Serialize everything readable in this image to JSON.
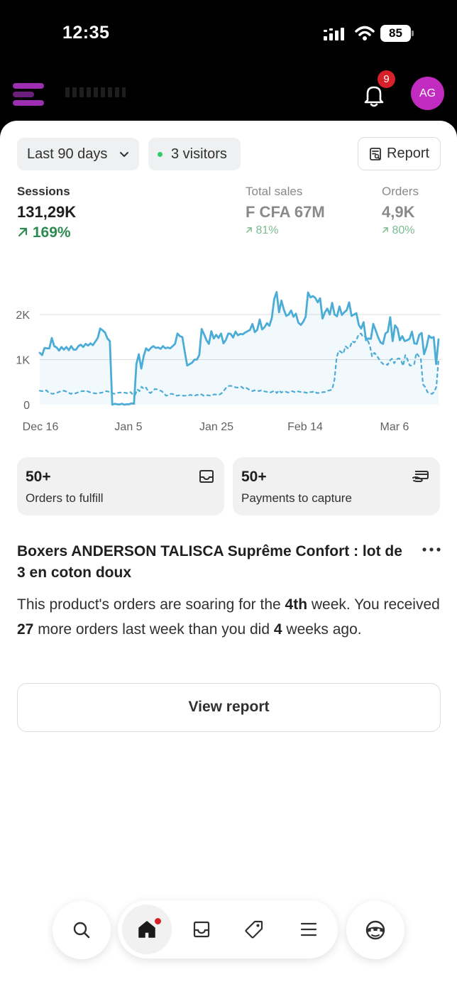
{
  "status_bar": {
    "time": "12:35",
    "battery": "85"
  },
  "header": {
    "notification_count": "9",
    "avatar_initials": "AG"
  },
  "filters": {
    "date_range": "Last 90 days",
    "visitors": "3 visitors",
    "report_button": "Report"
  },
  "metrics": [
    {
      "label": "Sessions",
      "value": "131,29K",
      "delta": "169%"
    },
    {
      "label": "Total sales",
      "value": "F CFA 67M",
      "delta": "81%"
    },
    {
      "label": "Orders",
      "value": "4,9K",
      "delta": "80%"
    }
  ],
  "chart_data": {
    "type": "line",
    "x_tick_labels": [
      "Dec 16",
      "Jan 5",
      "Jan 25",
      "Feb 14",
      "Mar 6"
    ],
    "y_tick_labels": [
      "2K",
      "1K",
      "0"
    ],
    "ylim": [
      0,
      2000
    ],
    "grid": true,
    "series": [
      {
        "style": "solid",
        "color": "#4bacd6",
        "values": [
          1150,
          1100,
          1260,
          1250,
          1250,
          1480,
          1300,
          1270,
          1200,
          1280,
          1220,
          1280,
          1210,
          1300,
          1220,
          1220,
          1300,
          1330,
          1280,
          1350,
          1310,
          1360,
          1320,
          1400,
          1480,
          1690,
          1650,
          1600,
          1470,
          1410,
          0,
          20,
          10,
          5,
          20,
          0,
          10,
          10,
          30,
          20,
          900,
          1120,
          800,
          1080,
          1250,
          1200,
          1260,
          1300,
          1260,
          1270,
          1240,
          1300,
          1250,
          1270,
          1250,
          1300,
          1350,
          1580,
          1520,
          1500,
          1170,
          870,
          900,
          930,
          1000,
          1000,
          1100,
          1680,
          1560,
          1430,
          1350,
          1630,
          1470,
          1550,
          1480,
          1580,
          1360,
          1440,
          1580,
          1570,
          1490,
          1620,
          1540,
          1570,
          1560,
          1600,
          1630,
          1660,
          1790,
          1610,
          1660,
          1890,
          1670,
          1720,
          1810,
          1750,
          1920,
          2340,
          2520,
          2050,
          2310,
          2110,
          1970,
          2000,
          2090,
          1950,
          2020,
          1820,
          1770,
          1840,
          1950,
          2490,
          2380,
          2410,
          2370,
          2270,
          2360,
          1910,
          2050,
          2130,
          2000,
          2260,
          2000,
          1960,
          2180,
          1990,
          2050,
          2100,
          2270,
          1970,
          2000,
          2030,
          1770,
          1690,
          1830,
          1430,
          1470,
          1460,
          1790,
          1650,
          1500,
          1380,
          1350,
          1580,
          1620,
          1940,
          1410,
          1760,
          1690,
          1430,
          1520,
          1410,
          1430,
          1460,
          1620,
          1360,
          1350,
          1550,
          1590,
          1120,
          1280,
          1530,
          1480,
          1500,
          900,
          1450
        ]
      },
      {
        "style": "dashed",
        "color": "#4bacd6",
        "values": [
          310,
          300,
          300,
          320,
          270,
          250,
          240,
          260,
          270,
          290,
          300,
          310,
          290,
          270,
          240,
          260,
          250,
          270,
          280,
          300,
          300,
          310,
          290,
          270,
          260,
          250,
          250,
          260,
          270,
          280,
          300,
          290,
          280,
          250,
          240,
          260,
          270,
          270,
          270,
          260,
          250,
          280,
          230,
          210,
          340,
          300,
          400,
          350,
          380,
          280,
          260,
          300,
          350,
          340,
          320,
          300,
          260,
          200,
          210,
          240,
          240,
          210,
          200,
          210,
          200,
          200,
          200,
          200,
          220,
          200,
          200,
          220,
          210,
          230,
          200,
          210,
          210,
          200,
          220,
          230,
          220,
          220,
          250,
          300,
          370,
          410,
          420,
          410,
          390,
          380,
          380,
          400,
          360,
          380,
          350,
          320,
          300,
          320,
          320,
          300,
          320,
          300,
          290,
          280,
          270,
          290,
          310,
          260,
          320,
          270,
          290,
          290,
          270,
          280,
          300,
          280,
          300,
          290,
          280,
          280,
          270,
          260,
          280,
          280,
          300,
          260,
          260,
          270,
          280,
          280,
          310,
          320,
          340,
          550,
          1050,
          1200,
          1170,
          1130,
          1300,
          1250,
          1270,
          1410,
          1380,
          1450,
          1560,
          1580,
          1500,
          1520,
          1430,
          1310,
          1070,
          1150,
          1100,
          1020,
          950,
          900,
          910,
          880,
          980,
          1020,
          920,
          1000,
          1030,
          1000,
          860,
          1100,
          1000,
          870,
          870,
          900,
          1150,
          1080,
          1020,
          450,
          390,
          280,
          250,
          240,
          280,
          400,
          1000
        ]
      }
    ]
  },
  "cards": [
    {
      "value": "50+",
      "label": "Orders to fulfill"
    },
    {
      "value": "50+",
      "label": "Payments to capture"
    }
  ],
  "insight": {
    "product_title": "Boxers ANDERSON TALISCA Suprême Confort : lot de 3 en coton doux",
    "text_1": "This product's orders are soaring for the ",
    "bold_1": "4th",
    "text_2": " week. You received ",
    "bold_2": "27",
    "text_3": " more orders last week than you did ",
    "bold_3": "4",
    "text_4": " weeks ago.",
    "button": "View report"
  },
  "colors": {
    "accent_avatar": "#c22bbf",
    "badge": "#d6202a",
    "positive": "#2e8a4e",
    "chart_line": "#4bacd6"
  },
  "icons": [
    "signal-icon",
    "wifi-icon",
    "battery-icon",
    "bell-icon",
    "chevron-down-icon",
    "report-icon",
    "trend-up-icon",
    "inbox-icon",
    "payment-icon",
    "more-icon",
    "search-icon",
    "home-icon",
    "tag-icon",
    "menu-icon",
    "sidekick-icon"
  ]
}
